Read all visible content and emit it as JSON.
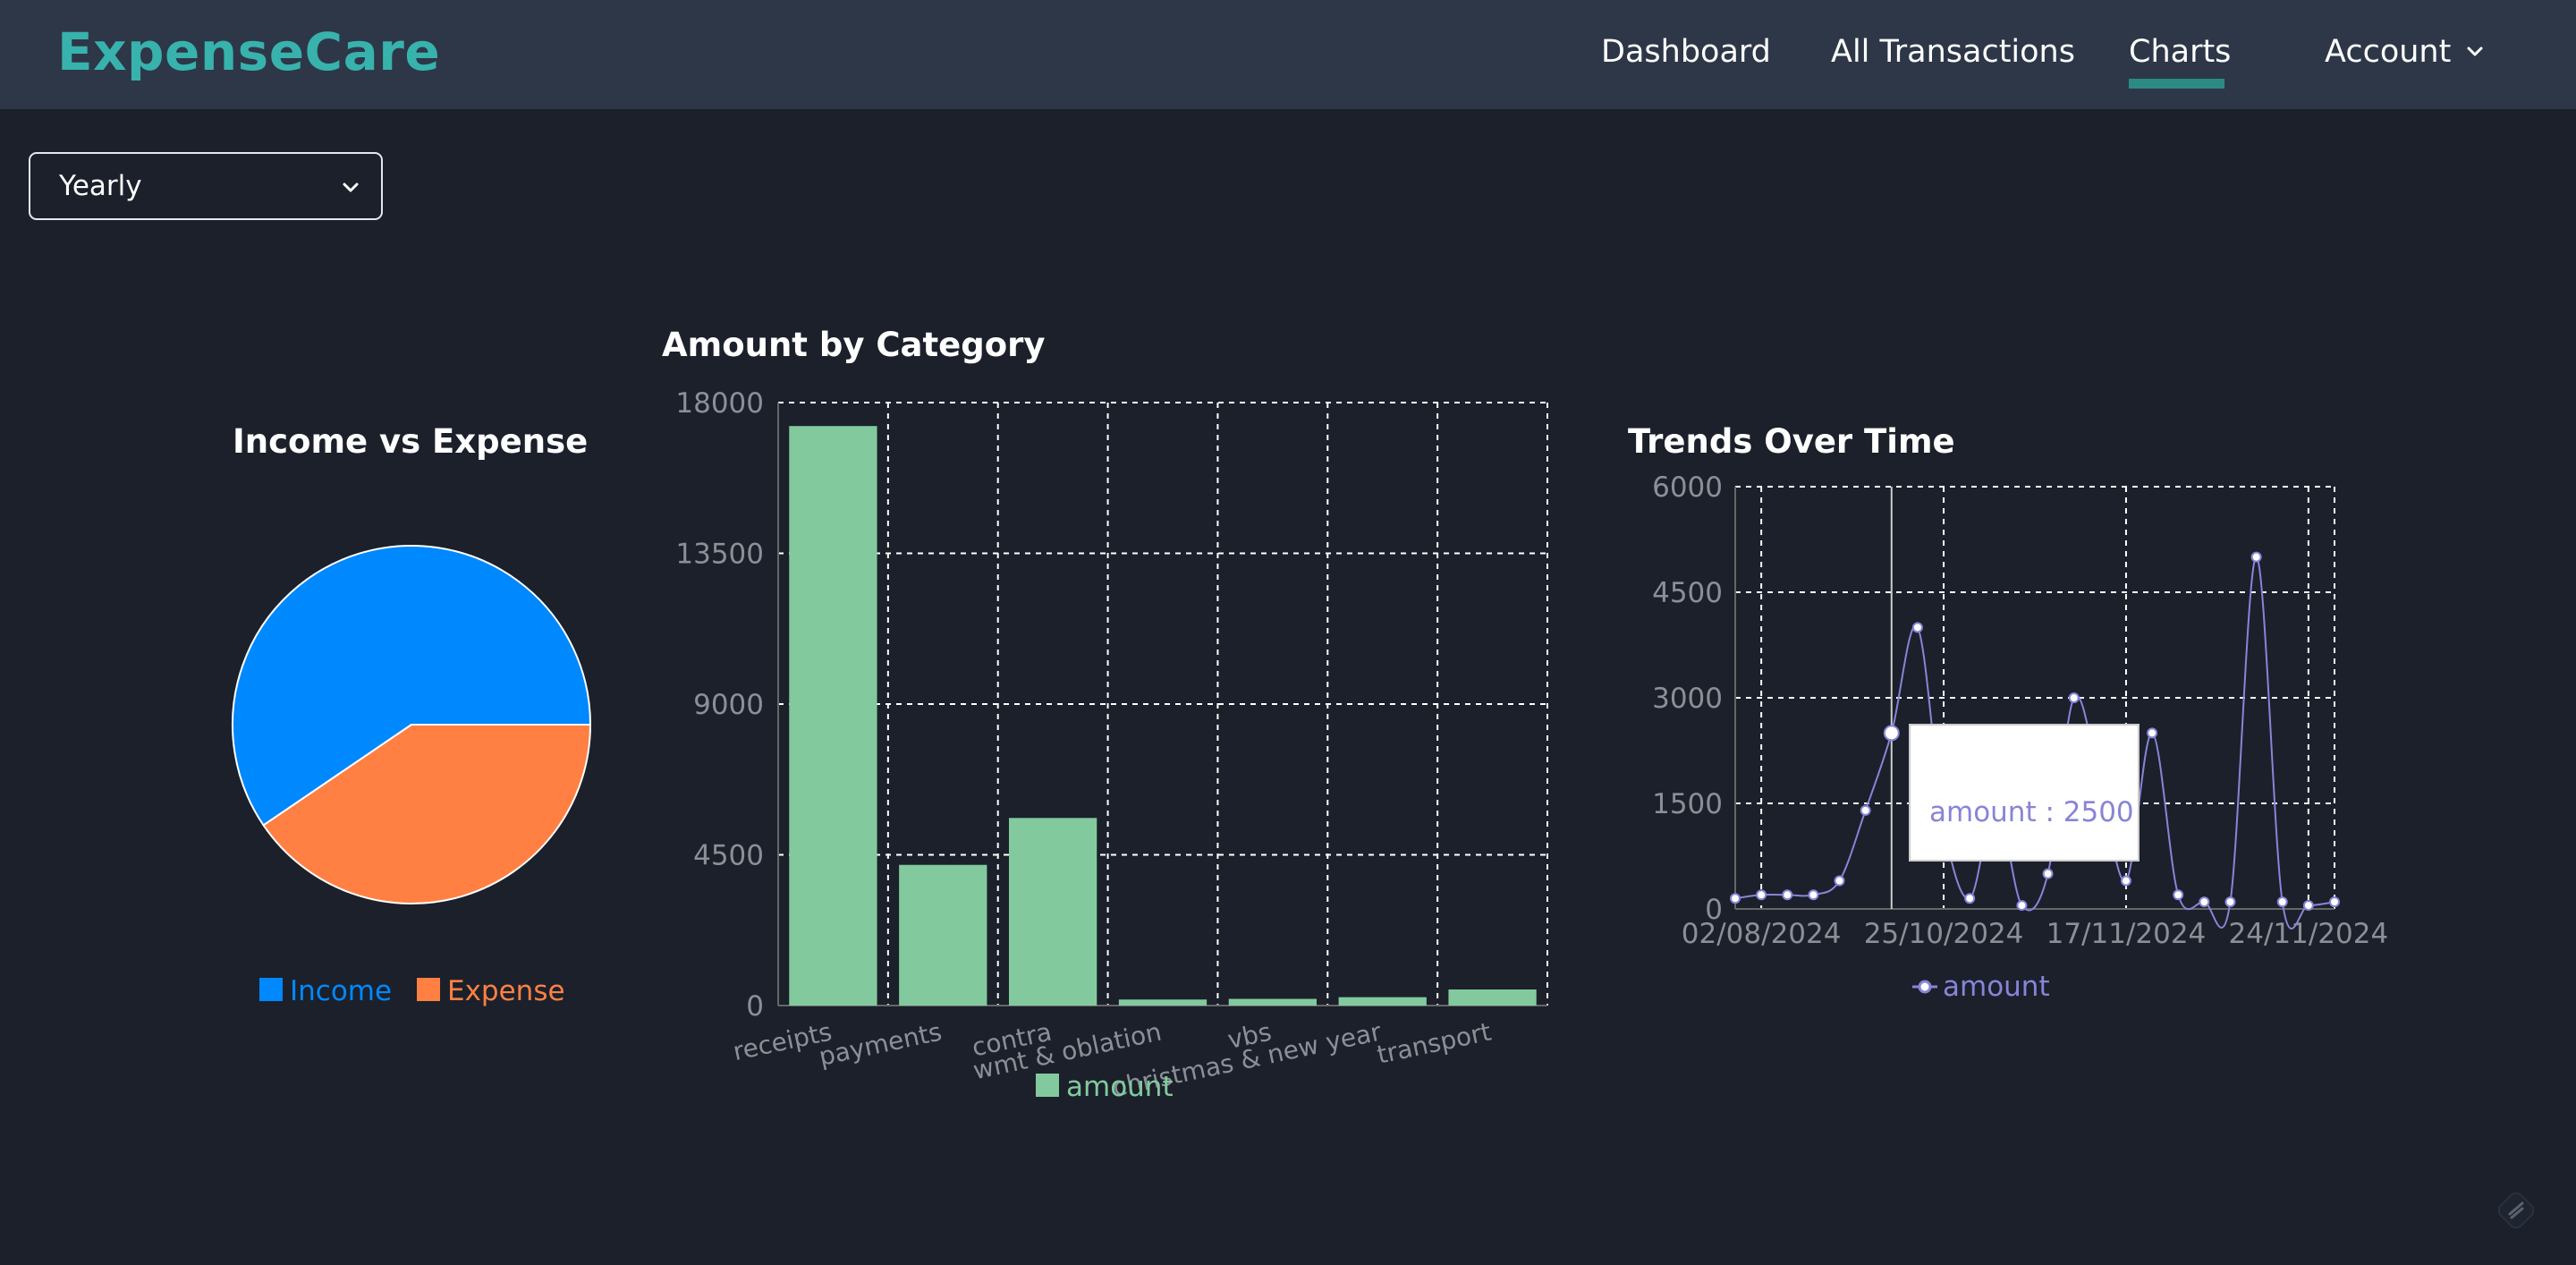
{
  "app": {
    "title": "ExpenseCare"
  },
  "nav": {
    "items": [
      {
        "label": "Dashboard"
      },
      {
        "label": "All Transactions"
      },
      {
        "label": "Charts"
      },
      {
        "label": "Account"
      }
    ],
    "active": "Charts"
  },
  "filter": {
    "period": "Yearly"
  },
  "colors": {
    "navbar_bg": "#2d3748",
    "page_bg": "#1b202b",
    "brand": "#38b2ac",
    "income": "#0088fe",
    "expense": "#ff8042",
    "bar": "#82ca9d",
    "line": "#8884d8"
  },
  "chart_data": [
    {
      "type": "pie",
      "title": "Income vs Expense",
      "labels": [
        "Income",
        "Expense"
      ],
      "values": [
        59.5,
        40.5
      ],
      "legend": "bottom"
    },
    {
      "type": "bar",
      "title": "Amount by Category",
      "categories": [
        "receipts",
        "payments",
        "contra",
        "wmt & oblation",
        "vbs",
        "christmas & new year",
        "transport"
      ],
      "series": [
        {
          "name": "amount",
          "values": [
            17300,
            4200,
            5600,
            180,
            200,
            250,
            480
          ]
        }
      ],
      "yticks": [
        "0",
        "4500",
        "9000",
        "13500",
        "18000"
      ],
      "ylim": [
        0,
        18000
      ],
      "grid": true,
      "legend": "bottom"
    },
    {
      "type": "line",
      "title": "Trends Over Time",
      "x_ticks": [
        "02/08/2024",
        "25/10/2024",
        "17/11/2024",
        "24/11/2024"
      ],
      "series": [
        {
          "name": "amount",
          "values": [
            150,
            200,
            200,
            200,
            400,
            1400,
            2500,
            4000,
            1200,
            150,
            1500,
            50,
            500,
            3000,
            1800,
            400,
            2500,
            200,
            100,
            100,
            5000,
            100,
            50,
            100
          ]
        }
      ],
      "yticks": [
        "0",
        "1500",
        "3000",
        "4500",
        "6000"
      ],
      "ylim": [
        0,
        6000
      ],
      "grid": true,
      "legend": "bottom",
      "tooltip": {
        "label": "amount : 2500",
        "value": 2500,
        "point_index": 6
      }
    }
  ]
}
